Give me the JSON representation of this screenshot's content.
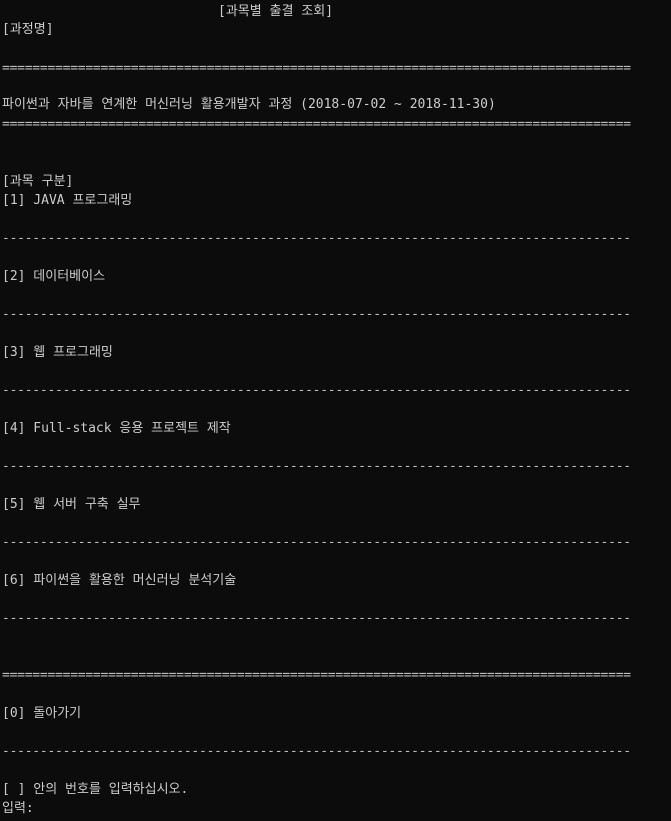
{
  "header": {
    "screen_title": "[과목별 출결 조회]",
    "course_label": "[과정명]"
  },
  "course": {
    "name": "파이썬과 자바를 연계한 머신러닝 활용개발자 과정 (2018-07-02 ~ 2018-11-30)"
  },
  "subjects_label": "[과목 구분]",
  "subjects": [
    {
      "label": "[1] JAVA 프로그래밍"
    },
    {
      "label": "[2] 데이터베이스"
    },
    {
      "label": "[3] 웹 프로그래밍"
    },
    {
      "label": "[4] Full-stack 응용 프로젝트 제작"
    },
    {
      "label": "[5] 웹 서버 구축 실무"
    },
    {
      "label": "[6] 파이썬을 활용한 머신러닝 분석기술"
    }
  ],
  "back_option": "[0] 돌아가기",
  "prompt": {
    "instruction": "[ ] 안의 번호를 입력하십시오.",
    "input_label": "입력:"
  },
  "rules": {
    "double": "===================================================================================",
    "single": "-----------------------------------------------------------------------------------"
  }
}
